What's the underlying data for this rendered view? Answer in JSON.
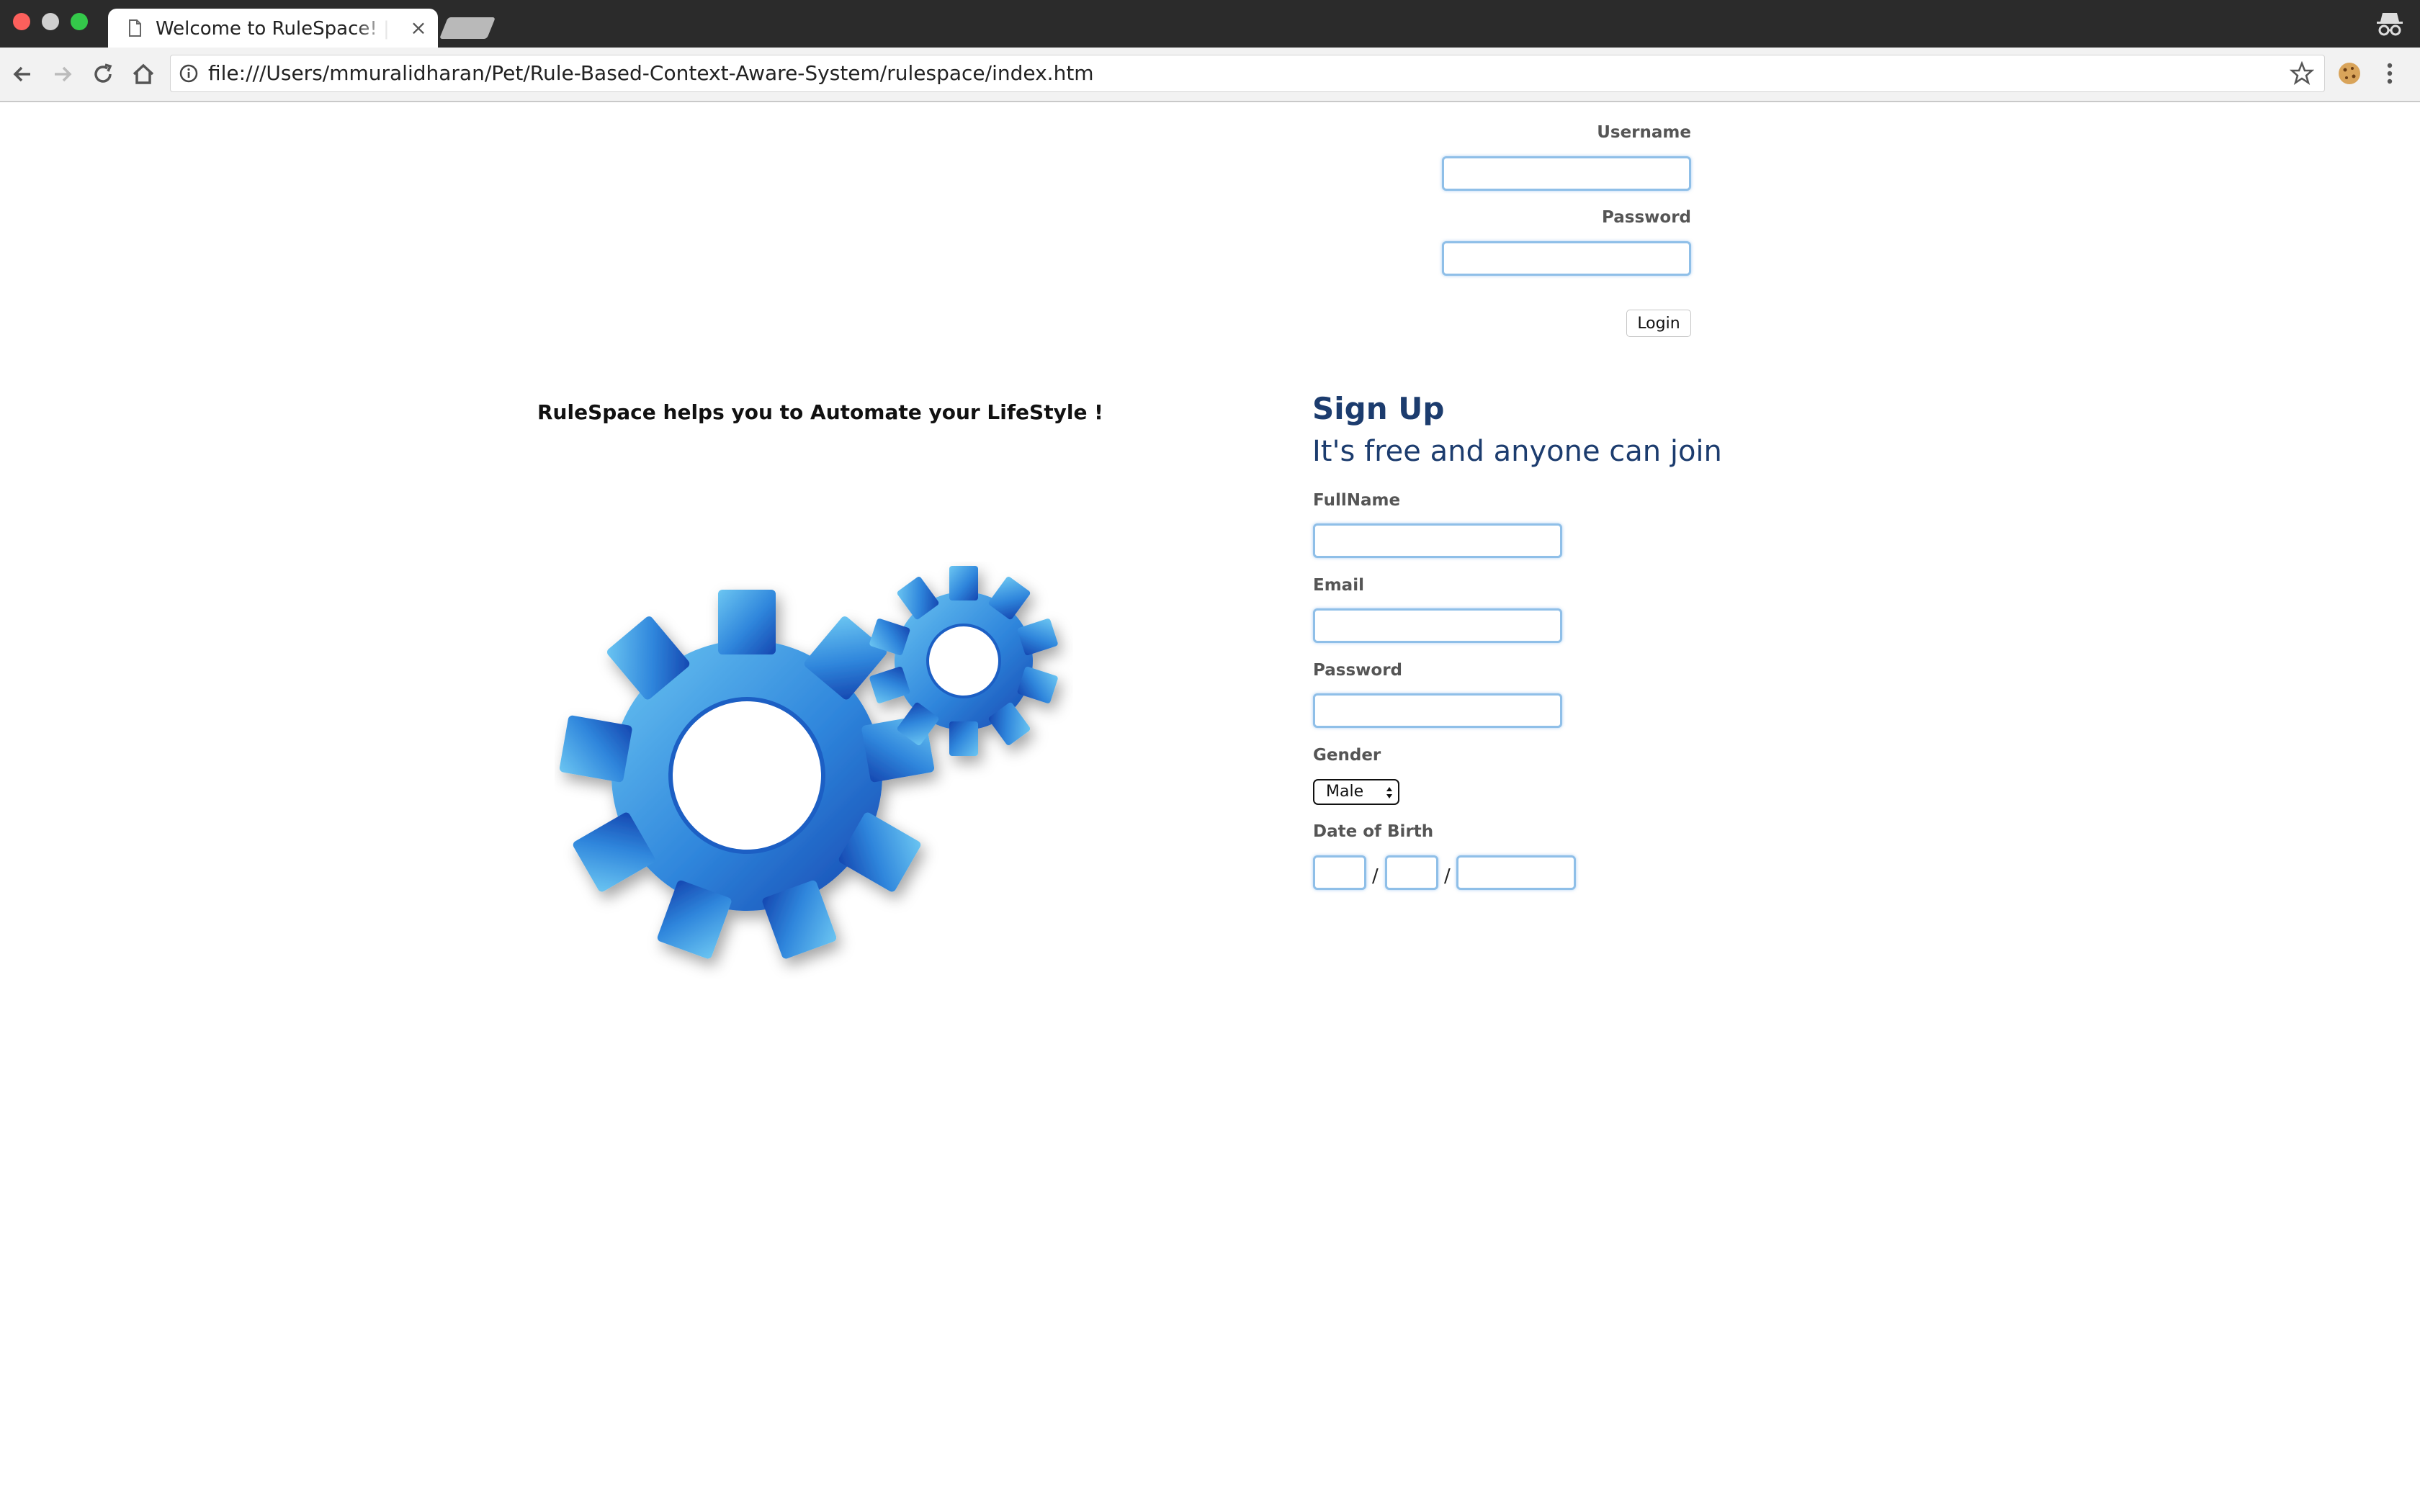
{
  "browser": {
    "tab_title": "Welcome to RuleSpace! | RuleSpace",
    "tab_close": "×",
    "url": "file:///Users/mmuralidharan/Pet/Rule-Based-Context-Aware-System/rulespace/index.htm",
    "icons": [
      "back-icon",
      "forward-icon",
      "reload-icon",
      "home-icon",
      "info-icon",
      "star-icon",
      "cookie-icon",
      "menu-icon",
      "incognito-icon"
    ]
  },
  "login": {
    "username_label": "Username",
    "username_value": "",
    "password_label": "Password",
    "password_value": "",
    "button_label": "Login"
  },
  "intro": {
    "tagline": "RuleSpace helps you to Automate your LifeStyle !",
    "image": "gears-icon"
  },
  "signup": {
    "title": "Sign Up",
    "subtitle": "It's free and anyone can join",
    "fullname_label": "FullName",
    "fullname_value": "",
    "email_label": "Email",
    "email_value": "",
    "password_label": "Password",
    "password_value": "",
    "gender_label": "Gender",
    "gender_value": "Male",
    "dob_label": "Date of Birth",
    "dob_separator": "/",
    "dob_day": "",
    "dob_month": "",
    "dob_year": ""
  },
  "colors": {
    "titlebar": "#2b2b2b",
    "toolbar": "#f2f2f2",
    "field_border": "#8fbfe8",
    "heading": "#1c3c6e",
    "gear_light": "#5ab8ec",
    "gear_dark": "#1a56c0"
  }
}
